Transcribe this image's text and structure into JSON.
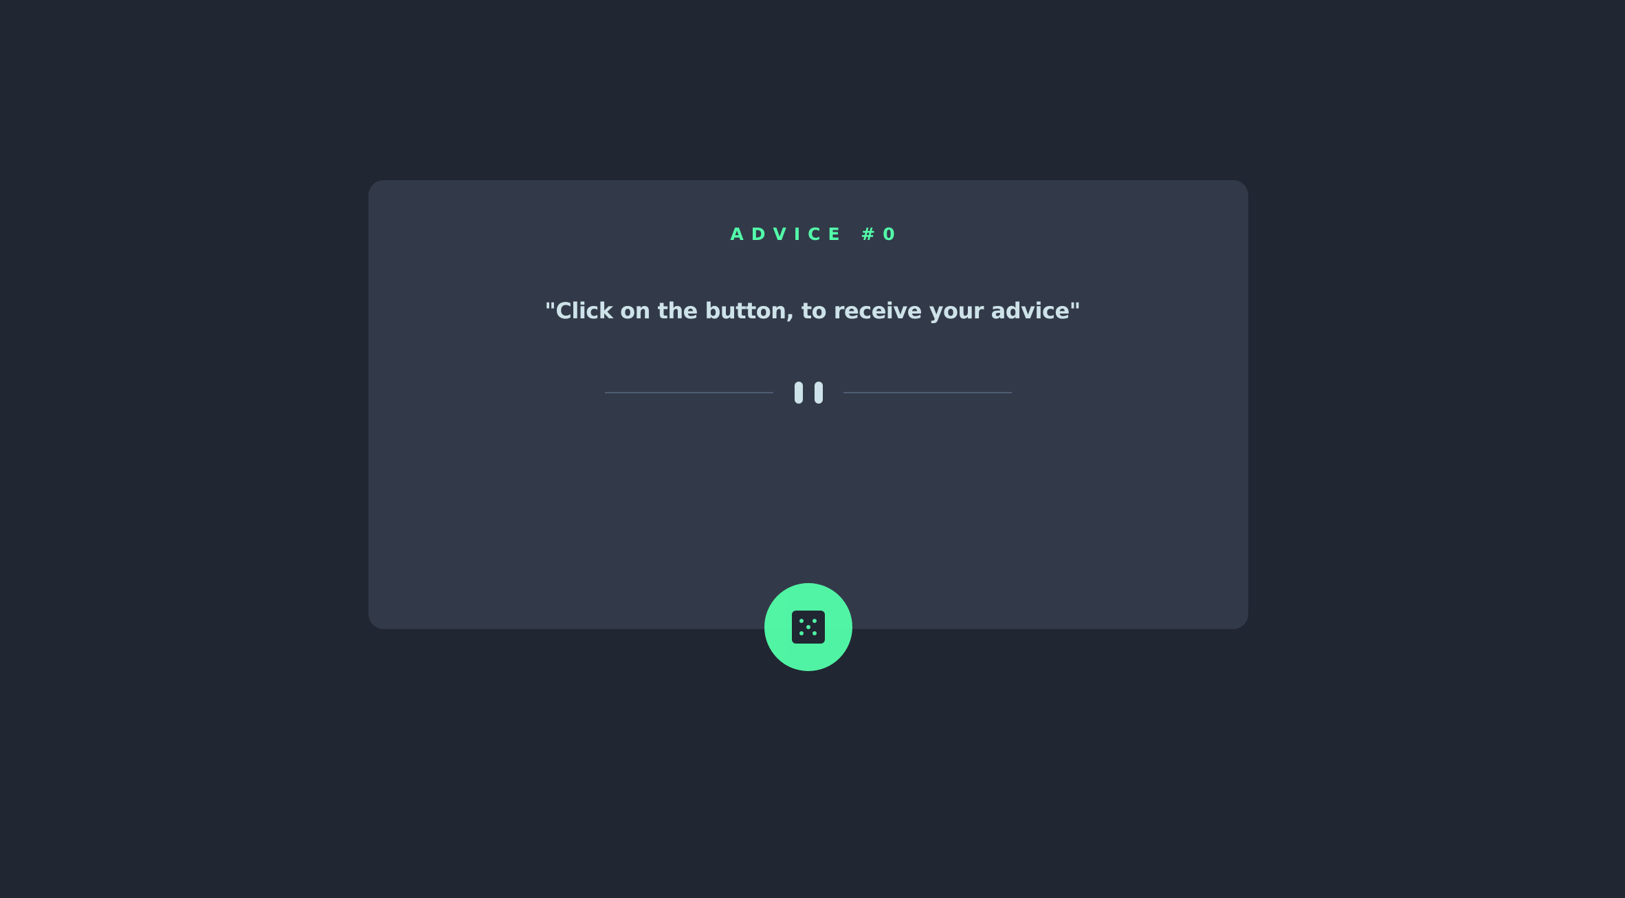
{
  "card": {
    "advice_label": "ADVICE #0",
    "quote": "\"Click on the button, to receive your advice\""
  },
  "divider": {
    "icon": "pause-divider-icon"
  },
  "dice_button": {
    "icon": "dice-icon",
    "accent_color": "#53ffaa"
  },
  "colors": {
    "background": "#202632",
    "card": "#323a49",
    "accent": "#53ffaa",
    "text": "#cee3e9",
    "divider": "#4f5d74"
  }
}
